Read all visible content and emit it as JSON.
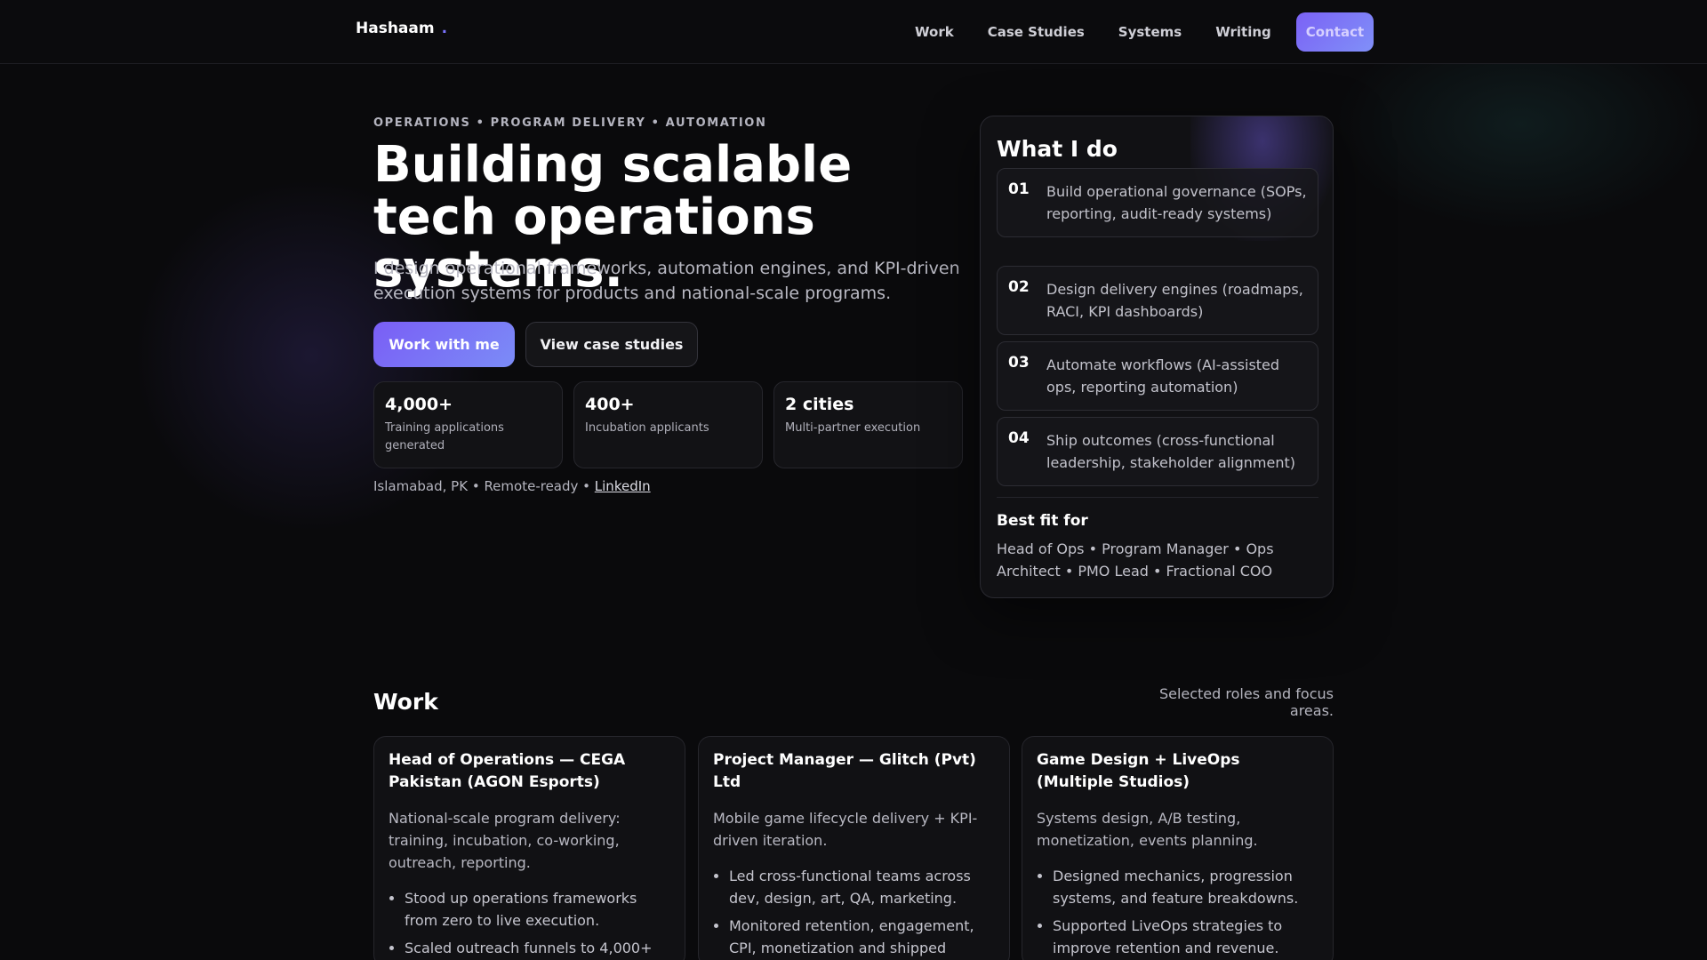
{
  "nav": {
    "brand": "Hashaam",
    "brand_dot": ".",
    "links": [
      "Work",
      "Case Studies",
      "Systems",
      "Writing"
    ],
    "contact": "Contact"
  },
  "hero": {
    "eyebrow": "OPERATIONS • PROGRAM DELIVERY • AUTOMATION",
    "title": "Building scalable tech operations systems.",
    "subtitle": "I design operational frameworks, automation engines, and KPI-driven execution systems for products and national-scale programs.",
    "primary_cta": "Work with me",
    "secondary_cta": "View case studies",
    "stats": [
      {
        "value": "4,000+",
        "label": "Training applications generated"
      },
      {
        "value": "400+",
        "label": "Incubation applicants"
      },
      {
        "value": "2 cities",
        "label": "Multi-partner execution"
      }
    ],
    "meta": "Islamabad, PK • Remote-ready • ",
    "meta_link": "LinkedIn"
  },
  "what_i_do": {
    "title": "What I do",
    "items": [
      {
        "num": "01",
        "text": "Build operational governance (SOPs, reporting, audit-ready systems)"
      },
      {
        "num": "02",
        "text": "Design delivery engines (roadmaps, RACI, KPI dashboards)"
      },
      {
        "num": "03",
        "text": "Automate workflows (AI-assisted ops, reporting automation)"
      },
      {
        "num": "04",
        "text": "Ship outcomes (cross-functional leadership, stakeholder alignment)"
      }
    ],
    "best_fit_title": "Best fit for",
    "best_fit_text": "Head of Ops • Program Manager • Ops Architect • PMO Lead • Fractional COO"
  },
  "work": {
    "title": "Work",
    "note": "Selected roles and focus areas.",
    "cards": [
      {
        "title": "Head of Operations — CEGA Pakistan (AGON Esports)",
        "desc": "National-scale program delivery: training, incubation, co-working, outreach, reporting.",
        "bullets": [
          "Stood up operations frameworks from zero to live execution.",
          "Scaled outreach funnels to 4,000+"
        ]
      },
      {
        "title": "Project Manager — Glitch (Pvt) Ltd",
        "desc": "Mobile game lifecycle delivery + KPI-driven iteration.",
        "bullets": [
          "Led cross-functional teams across dev, design, art, QA, marketing.",
          "Monitored retention, engagement, CPI, monetization and shipped improvements."
        ]
      },
      {
        "title": "Game Design + LiveOps (Multiple Studios)",
        "desc": "Systems design, A/B testing, monetization, events planning.",
        "bullets": [
          "Designed mechanics, progression systems, and feature breakdowns.",
          "Supported LiveOps strategies to improve retention and revenue."
        ]
      }
    ]
  }
}
